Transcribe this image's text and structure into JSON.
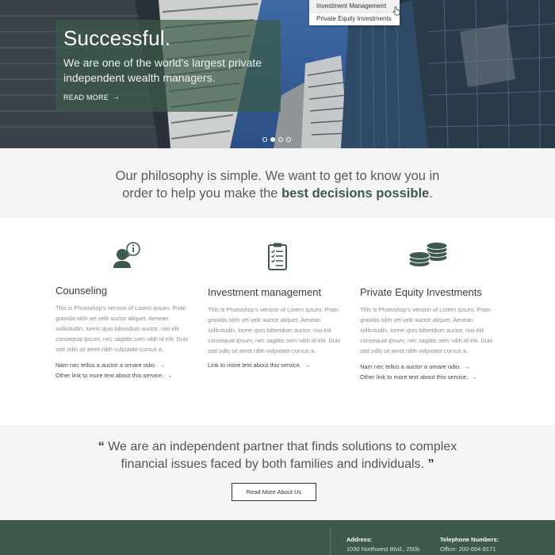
{
  "hero": {
    "title": "Successful.",
    "subtitle": "We are one of the world’s largest private independent wealth managers.",
    "link_label": "READ MORE",
    "link_arrow": "→",
    "slides_total": 4,
    "active_slide": 2
  },
  "dropdown": {
    "items": [
      "Investment Management",
      "Private Equity Investments"
    ],
    "active_index": 0
  },
  "philosophy": {
    "text_line1": "Our philosophy is simple. We want to get to know you in",
    "text_line2_prefix": "order to help you make the ",
    "text_line2_bold": "best decisions possible",
    "text_line2_suffix": "."
  },
  "services": [
    {
      "icon": "counseling-person-info-icon",
      "title": "Counseling",
      "description": "This is Photoshop’s version  of Lorem Ipsum. Proin gravida nibh vel velit auctor aliquet. Aenean sollicitudin, lorem quis bibendum auctor, nisi elit consequat ipsum, nec sagittis sem nibh id elit. Duis sed odio sit amet nibh vulputate cursus a.",
      "links": [
        "Nam nec tellus a auctor a ornare odio.",
        "Other link to more text about this service."
      ]
    },
    {
      "icon": "clipboard-checklist-icon",
      "title": "Investment management",
      "description": "This is Photoshop’s version  of Lorem Ipsum. Proin gravida nibh vel velit auctor aliquet. Aenean sollicitudin, lorem quis bibendum auctor, nisi elit consequat ipsum, nec sagittis sem nibh id elit. Duis sed odio sit amet nibh vulputate cursus a.",
      "links": [
        "Link to more text about this service."
      ]
    },
    {
      "icon": "coin-stacks-icon",
      "title": "Private Equity Investments",
      "description": "This is Photoshop’s version  of Lorem Ipsum. Proin gravida nibh vel velit auctor aliquet. Aenean sollicitudin, lorem quis bibendum auctor, nisi elit consequat ipsum, nec sagittis sem nibh id elit. Duis sed odio sit amet nibh vulputate cursus a.",
      "links": [
        "Nam nec tellus a auctor a ornare odio.",
        "Other link to more text about this service."
      ]
    }
  ],
  "link_arrow": "→",
  "quote": {
    "open_mark": "“",
    "line1": "We are an independent partner that finds solutions to complex",
    "line2": "financial issues faced by both families and individuals.",
    "close_mark": "”",
    "button_label": "Read More About Us"
  },
  "footer": {
    "address_label": "Address:",
    "address_value": "1030 Northwest Blvd., 250b",
    "phone_label": "Telephone Numbers:",
    "phone_value": "Office: 200-664-9171"
  },
  "colors": {
    "brand_green": "#3e5a4c",
    "hero_panel": "#3c5a48",
    "section_gray": "#f5f5f5"
  }
}
